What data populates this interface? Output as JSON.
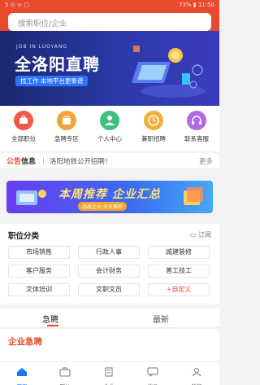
{
  "status_bar": {
    "left": "5 ⊙ ᯤ ▢",
    "right": "73% ▮ 11:50"
  },
  "search": {
    "placeholder": "搜索职位/企业"
  },
  "banner": {
    "subtitle": "JOB IN LUOYANG",
    "title": "全洛阳直聘",
    "slogan": "找工作 本地平台更靠谱"
  },
  "shortcuts": [
    {
      "label": "全部职位",
      "icon": "briefcase-icon",
      "color": "#ee5a47"
    },
    {
      "label": "急聘专区",
      "icon": "bag-icon",
      "color": "#f0a43a"
    },
    {
      "label": "个人中心",
      "icon": "person-icon",
      "color": "#3cc27b"
    },
    {
      "label": "兼职招聘",
      "icon": "clock-icon",
      "color": "#f2ae3d"
    },
    {
      "label": "联系客服",
      "icon": "headset-icon",
      "color": "#b06ae4"
    }
  ],
  "notice": {
    "tag_a": "公告",
    "tag_b": "信息",
    "message": "洛阳地铁公开招聘！",
    "more": "更多"
  },
  "promo": {
    "title": "本周推荐 企业汇总",
    "subtitle": "品质企业 多多推荐"
  },
  "categories": {
    "title": "职位分类",
    "action": "▭ 订阅",
    "items": [
      "市场销售",
      "行政人事",
      "城建装修",
      "客户服务",
      "会计财务",
      "普工技工",
      "文体培训",
      "文职文员",
      "+自定义"
    ]
  },
  "tabs": {
    "urgent": "急聘",
    "latest": "最新"
  },
  "section": {
    "title": "企业急聘"
  },
  "nav": [
    {
      "label": "首页",
      "icon": "home-icon"
    },
    {
      "label": "职位",
      "icon": "briefcase-icon"
    },
    {
      "label": "企业",
      "icon": "building-icon"
    },
    {
      "label": "消息",
      "icon": "message-icon"
    },
    {
      "label": "我的",
      "icon": "user-icon"
    }
  ],
  "colors": {
    "brand": "#e94a2e",
    "nav_active": "#1677ff"
  }
}
